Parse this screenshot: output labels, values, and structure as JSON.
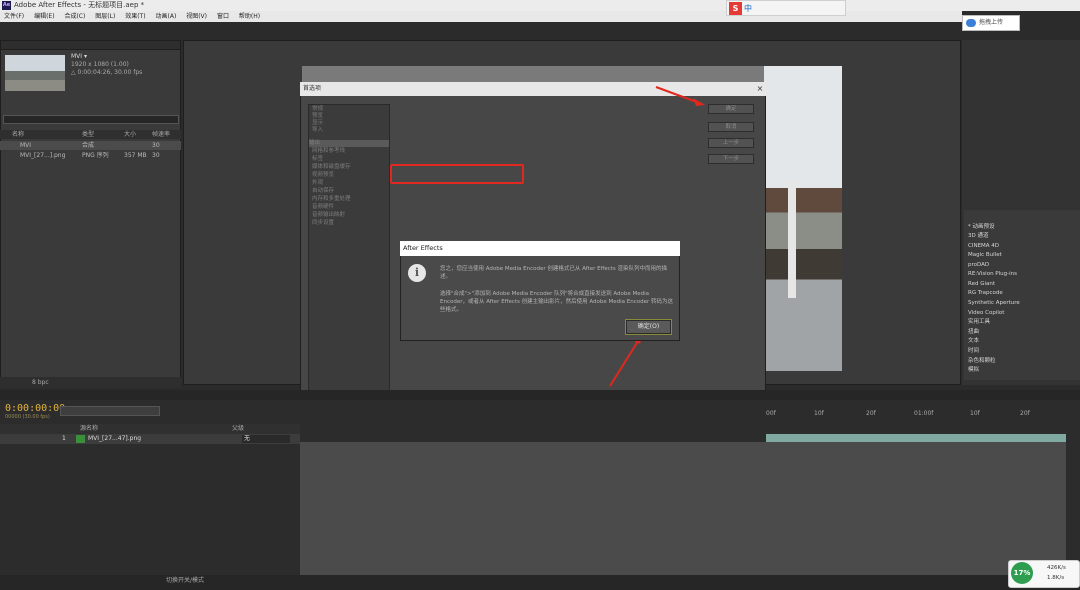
{
  "app": {
    "title": "Adobe After Effects - 无标题项目.aep *"
  },
  "menu": [
    "文件(F)",
    "编辑(E)",
    "合成(C)",
    "图层(L)",
    "效果(T)",
    "动画(A)",
    "视图(V)",
    "窗口",
    "帮助(H)"
  ],
  "ime": {
    "label": "中"
  },
  "cloud": {
    "label": "拖拽上传"
  },
  "project": {
    "comp_name": "MVI ▾",
    "comp_size": "1920 x 1080 (1.00)",
    "comp_duration": "△ 0:00:04:26, 30.00 fps",
    "columns": [
      "名称",
      "类型",
      "大小",
      "帧速率"
    ],
    "items": [
      {
        "name": "MVI",
        "type": "合成",
        "size": "",
        "fps": "30"
      },
      {
        "name": "MVI_[27...].png",
        "type": "PNG 序列",
        "size": "357 MB",
        "fps": "30"
      }
    ],
    "bpc": "8 bpc"
  },
  "prefs": {
    "title": "首选项",
    "close": "×",
    "categories": [
      "常规",
      "预览",
      "显示",
      "导入",
      "输出",
      "网格和参考线",
      "标签",
      "媒体和磁盘缓存",
      "视频预览",
      "外观",
      "自动保存",
      "内存和多重处理",
      "音频硬件",
      "音频输出映射",
      "同步设置"
    ],
    "buttons": [
      "确定",
      "取消",
      "上一步",
      "下一步"
    ]
  },
  "alert": {
    "title": "After Effects",
    "message1": "您之，您应当使用 Adobe Media Encoder 创建格式已从 After Effects 渲染队列中而用的描述。",
    "message2": "选择\"合成\">\"添加到 Adobe Media Encoder 队列\"将合成直接发送到 Adobe Media Encoder，或者从 After Effects 创建主输出影片，然后使用 Adobe Media Encoder 转码为这些格式。",
    "ok": "确定(O)"
  },
  "effects": [
    "* 动画预设",
    "3D 通道",
    "CINEMA 4D",
    "Magic Bullet",
    "proDAD",
    "RE:Vision Plug-ins",
    "Red Giant",
    "RG Trapcode",
    "Synthetic Aperture",
    "Video Copilot",
    "实用工具",
    "扭曲",
    "文本",
    "时间",
    "杂色和颗粒",
    "模拟"
  ],
  "timeline": {
    "timecode": "0:00:00:00",
    "sub": "00000 (30.00 fps)",
    "col_name": "源名称",
    "col_parent": "父级",
    "layer_index": "1",
    "layer_name": "MVI_[27...47].png",
    "parent": "无",
    "ruler": [
      "00f",
      "10f",
      "20f",
      "01:00f",
      "10f",
      "20f"
    ],
    "footer": "切换开关/模式"
  },
  "network": {
    "percent": "17%",
    "up": "426K/s",
    "down": "1.8K/s"
  },
  "colors": {
    "accent_red": "#e0281f",
    "timecode": "#e3b43c",
    "track": "#7fa9a1"
  }
}
